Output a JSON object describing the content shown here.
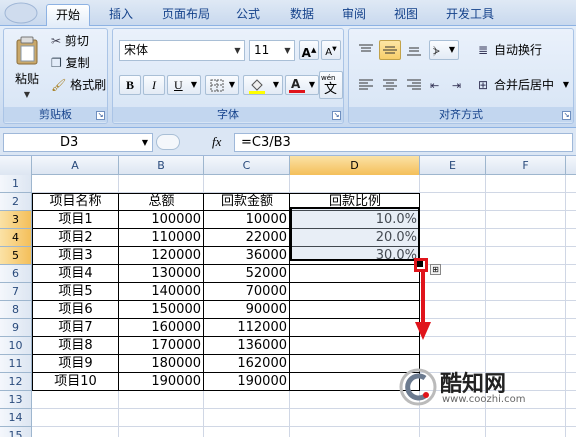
{
  "ribbon": {
    "tabs": [
      "开始",
      "插入",
      "页面布局",
      "公式",
      "数据",
      "审阅",
      "视图",
      "开发工具"
    ],
    "active_tab": "开始",
    "clipboard": {
      "paste": "粘贴",
      "cut": "剪切",
      "copy": "复制",
      "format_painter": "格式刷",
      "group_label": "剪贴板"
    },
    "font": {
      "font_name": "宋体",
      "font_size": "11",
      "bold": "B",
      "italic": "I",
      "underline": "U",
      "font_color_letter": "A",
      "phonetic": "wén",
      "group_label": "字体"
    },
    "alignment": {
      "wrap_text": "自动换行",
      "merge_center": "合并后居中",
      "group_label": "对齐方式"
    }
  },
  "formula_bar": {
    "name_box": "D3",
    "fx": "fx",
    "formula": "=C3/B3"
  },
  "sheet": {
    "columns": [
      "A",
      "B",
      "C",
      "D",
      "E",
      "F"
    ],
    "active_column": "D",
    "rows": [
      "1",
      "2",
      "3",
      "4",
      "5",
      "6",
      "7",
      "8",
      "9",
      "10",
      "11",
      "12",
      "13",
      "14",
      "15"
    ],
    "headers": [
      "项目名称",
      "总额",
      "回款金额",
      "回款比例"
    ],
    "data": [
      [
        "项目1",
        "100000",
        "10000",
        "10.0%"
      ],
      [
        "项目2",
        "110000",
        "22000",
        "20.0%"
      ],
      [
        "项目3",
        "120000",
        "36000",
        "30.0%"
      ],
      [
        "项目4",
        "130000",
        "52000",
        ""
      ],
      [
        "项目5",
        "140000",
        "70000",
        ""
      ],
      [
        "项目6",
        "150000",
        "90000",
        ""
      ],
      [
        "项目7",
        "160000",
        "112000",
        ""
      ],
      [
        "项目8",
        "170000",
        "136000",
        ""
      ],
      [
        "项目9",
        "180000",
        "162000",
        ""
      ],
      [
        "项目10",
        "190000",
        "190000",
        ""
      ]
    ]
  },
  "watermark": {
    "name": "酷知网",
    "url": "www.coozhi.com"
  },
  "colors": {
    "annotation_red": "#e0141b",
    "selection_border": "#000000"
  }
}
